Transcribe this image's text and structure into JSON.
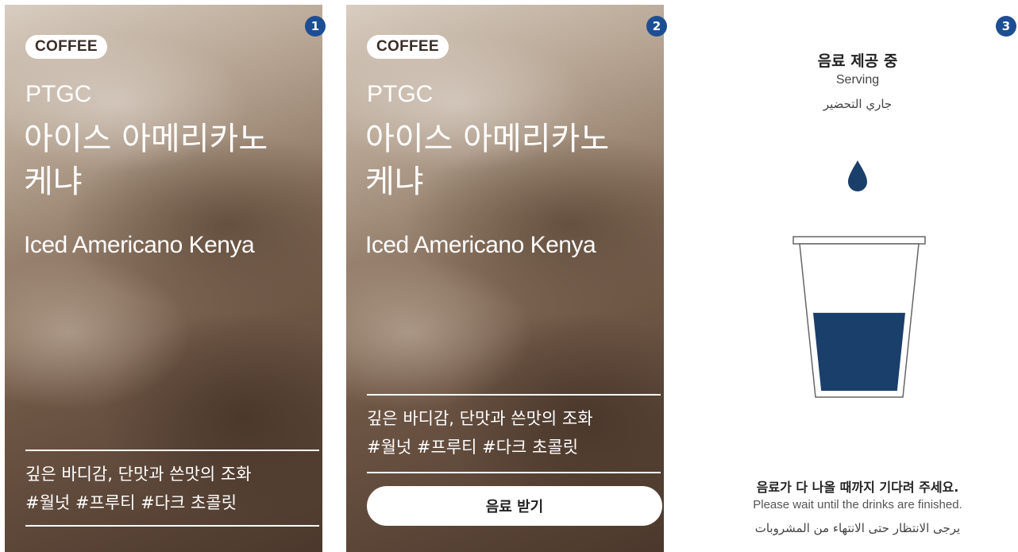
{
  "panels": [
    {
      "step": "1",
      "category": "COFFEE",
      "brand": "PTGC",
      "name_ko": "아이스 아메리카노\n케냐",
      "name_en": "Iced Americano Kenya",
      "description_line1": "깊은 바디감, 단맛과 쓴맛의 조화",
      "description_line2": "#월넛 #프루티 #다크 초콜릿"
    },
    {
      "step": "2",
      "category": "COFFEE",
      "brand": "PTGC",
      "name_ko": "아이스 아메리카노\n케냐",
      "name_en": "Iced Americano Kenya",
      "description_line1": "깊은 바디감, 단맛과 쓴맛의 조화",
      "description_line2": "#월넛 #프루티 #다크 초콜릿",
      "button_label": "음료 받기"
    }
  ],
  "serving": {
    "step": "3",
    "title_ko": "음료 제공 중",
    "title_en": "Serving",
    "title_ar": "جاري التحضير",
    "wait_ko": "음료가 다 나올 때까지 기다려 주세요.",
    "wait_en": "Please wait until the drinks are finished.",
    "wait_ar": "يرجى الانتظار حتى الانتهاء من المشروبات",
    "fill_level": 0.55,
    "colors": {
      "liquid": "#1b3f6b",
      "badge": "#1d4e94"
    }
  }
}
